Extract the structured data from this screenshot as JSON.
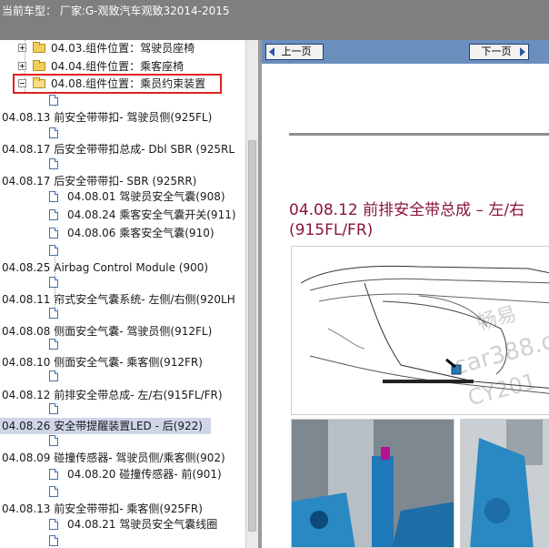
{
  "window": {
    "title": "当前车型：  厂家:G-观致汽车观致32014-2015"
  },
  "tree": {
    "nodes": [
      {
        "id": "n1",
        "label": "04.03.组件位置：驾驶员座椅"
      },
      {
        "id": "n2",
        "label": "04.04.组件位置：乘客座椅"
      },
      {
        "id": "n3",
        "label": "04.08.组件位置：乘员约束装置"
      },
      {
        "id": "n4",
        "label": "04.08.13 前安全带带扣- 驾驶员侧(925FL)"
      },
      {
        "id": "n5",
        "label": "04.08.17 后安全带带扣总成- Dbl SBR (925RL"
      },
      {
        "id": "n6",
        "label": "04.08.17 后安全带带扣- SBR (925RR)"
      },
      {
        "id": "n7",
        "label": "04.08.01 驾驶员安全气囊(908)"
      },
      {
        "id": "n8",
        "label": "04.08.24 乘客安全气囊开关(911)"
      },
      {
        "id": "n9",
        "label": "04.08.06 乘客安全气囊(910)"
      },
      {
        "id": "n10",
        "label": "04.08.25 Airbag Control Module (900)"
      },
      {
        "id": "n11",
        "label": "04.08.11 帘式安全气囊系统- 左侧/右侧(920LH"
      },
      {
        "id": "n12",
        "label": "04.08.08 侧面安全气囊- 驾驶员侧(912FL)"
      },
      {
        "id": "n13",
        "label": "04.08.10 侧面安全气囊- 乘客侧(912FR)"
      },
      {
        "id": "n14",
        "label": "04.08.12 前排安全带总成- 左/右(915FL/FR)"
      },
      {
        "id": "n15",
        "label": "04.08.26 安全带提醒装置LED - 后(922)"
      },
      {
        "id": "n16",
        "label": "04.08.09 碰撞传感器- 驾驶员侧/乘客侧(902)"
      },
      {
        "id": "n17",
        "label": "04.08.20 碰撞传感器- 前(901)"
      },
      {
        "id": "n18",
        "label": "04.08.13 前安全带带扣- 乘客侧(925FR)"
      },
      {
        "id": "n19",
        "label": "04.08.21 驾驶员安全气囊线圈"
      }
    ]
  },
  "content": {
    "prev_label": "上一页",
    "next_label": "下一页",
    "title": "04.08.12 前排安全带总成 – 左/右 (915FL/FR)",
    "watermark_cn": "畅易",
    "watermark_url": "car388.c",
    "watermark_code": "CY201"
  },
  "colors": {
    "title_red": "#8a1538",
    "nav_blue": "#6b8fbd",
    "highlight_border": "#e02020",
    "selected_bg": "#cfd6e8",
    "part_blue": "#1f79b8"
  }
}
